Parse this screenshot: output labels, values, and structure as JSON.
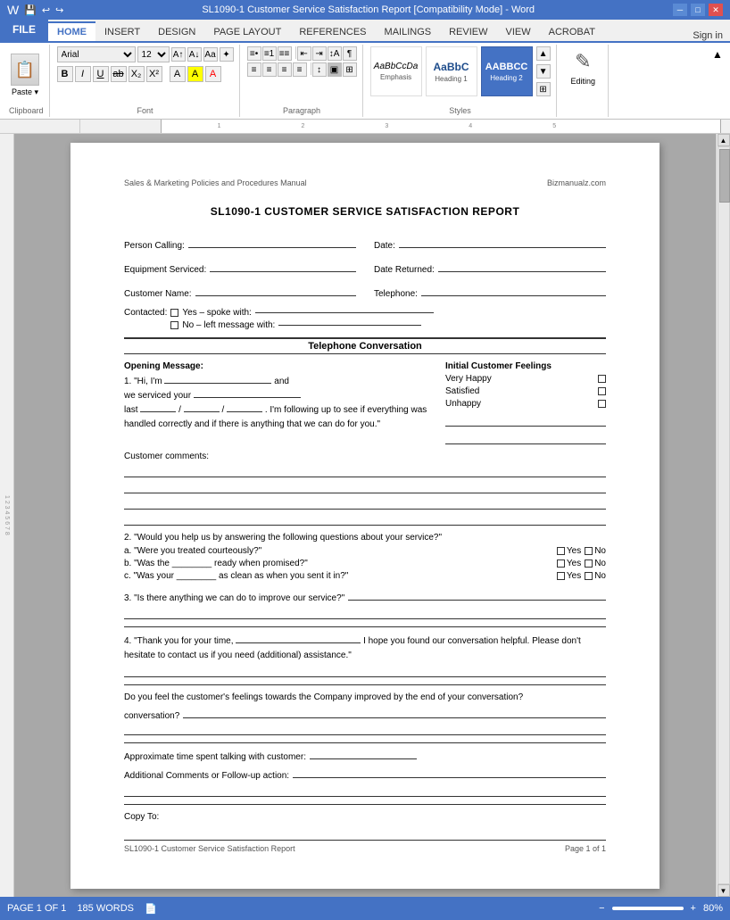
{
  "titlebar": {
    "title": "SL1090-1 Customer Service Satisfaction Report [Compatibility Mode] - Word",
    "app": "Word",
    "controls": [
      "minimize",
      "restore",
      "close"
    ]
  },
  "ribbon": {
    "tabs": [
      "FILE",
      "HOME",
      "INSERT",
      "DESIGN",
      "PAGE LAYOUT",
      "REFERENCES",
      "MAILINGS",
      "REVIEW",
      "VIEW",
      "ACROBAT"
    ],
    "active_tab": "HOME",
    "sign_in": "Sign in",
    "groups": {
      "clipboard": {
        "label": "Clipboard",
        "paste_label": "Paste"
      },
      "font": {
        "label": "Font",
        "font_name": "Arial",
        "font_size": "12",
        "bold": "B",
        "italic": "I",
        "underline": "U"
      },
      "paragraph": {
        "label": "Paragraph"
      },
      "styles": {
        "label": "Styles",
        "items": [
          {
            "preview": "AaBbCcDa",
            "label": "Emphasis"
          },
          {
            "preview": "AaBbC",
            "label": "Heading 1"
          },
          {
            "preview": "AABBCC",
            "label": "Heading 2",
            "active": true
          }
        ]
      },
      "editing": {
        "label": "Editing",
        "icon": "✏",
        "label_text": "Editing"
      }
    }
  },
  "document": {
    "header_left": "Sales & Marketing Policies and Procedures Manual",
    "header_right": "Bizmanualz.com",
    "title": "SL1090-1 CUSTOMER SERVICE SATISFACTION REPORT",
    "fields": {
      "person_calling": "Person Calling:",
      "date": "Date:",
      "equipment_serviced": "Equipment Serviced:",
      "date_returned": "Date Returned:",
      "customer_name": "Customer Name:",
      "telephone": "Telephone:",
      "contacted": "Contacted:",
      "yes_spoke": "Yes – spoke with:",
      "no_left": "No – left message with:"
    },
    "section_title": "Telephone Conversation",
    "opening_message_label": "Opening Message:",
    "opening_message_num": "1.",
    "opening_message_text": "\"Hi, I'm",
    "opening_message_and": "and",
    "opening_message_line2": "we serviced your",
    "opening_message_line3": "last ___/___/___.",
    "opening_message_cont": "I'm following up to see if everything was handled correctly and if there is anything that we can do for you.\"",
    "initial_feelings_label": "Initial Customer Feelings",
    "feelings": [
      {
        "label": "Very Happy",
        "checked": false
      },
      {
        "label": "Satisfied",
        "checked": false
      },
      {
        "label": "Unhappy",
        "checked": false
      }
    ],
    "customer_comments": "Customer comments:",
    "question2": "2. \"Would you help us by answering the following questions about your service?\"",
    "sub_questions": [
      {
        "text": "a. \"Were you treated courteously?\""
      },
      {
        "text": "b. \"Was the ________ ready when promised?\""
      },
      {
        "text": "c. \"Was your ________ as clean as when you sent it in?\""
      }
    ],
    "question3_label": "3. \"Is there anything we can do to improve our service?\"",
    "question4_label": "4. \"Thank you for your time,",
    "question4_cont": "I hope you found our conversation helpful. Please don't hesitate to contact us if you need (additional) assistance.\"",
    "improved_label": "Do you feel the customer's feelings towards the Company improved by the end of your conversation?",
    "approx_time": "Approximate time spent talking with customer:",
    "additional_comments": "Additional Comments or Follow-up action:",
    "copy_to": "Copy To:",
    "footer_left": "SL1090-1 Customer Service Satisfaction Report",
    "footer_right": "Page 1 of 1"
  },
  "statusbar": {
    "page_info": "PAGE 1 OF 1",
    "words": "185 WORDS",
    "zoom": "80%"
  }
}
